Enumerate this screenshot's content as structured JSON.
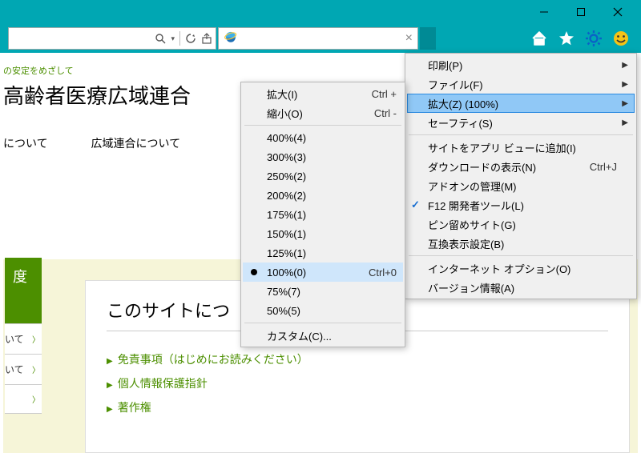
{
  "window": {
    "title": ""
  },
  "titlebar_icons": {
    "minimize": "minimize",
    "maximize": "maximize",
    "close": "close"
  },
  "addressbar": {
    "search_dropdown": "▾",
    "icons": {
      "refresh": "refresh",
      "share": "share"
    },
    "tab": {
      "close": "×"
    },
    "right_icons": {
      "home": "home",
      "star": "star",
      "gear": "gear",
      "smiley": "smiley"
    }
  },
  "page": {
    "tagline": "の安定をめざして",
    "title": "高齢者医療広域連合",
    "nav": [
      "について",
      "広域連合について"
    ],
    "side_tab": "度",
    "side_items": [
      "いて",
      "いて"
    ],
    "panel_heading": "このサイトにつ",
    "panel_links": [
      "免責事項（はじめにお読みください）",
      "個人情報保護指針",
      "著作権"
    ]
  },
  "settings_menu": {
    "items": [
      {
        "label": "印刷(P)",
        "sub": true
      },
      {
        "label": "ファイル(F)",
        "sub": true
      },
      {
        "label": "拡大(Z) (100%)",
        "sub": true,
        "highlight": true
      },
      {
        "label": "セーフティ(S)",
        "sub": true
      }
    ],
    "items2": [
      {
        "label": "サイトをアプリ ビューに追加(I)"
      },
      {
        "label": "ダウンロードの表示(N)",
        "shortcut": "Ctrl+J"
      },
      {
        "label": "アドオンの管理(M)"
      },
      {
        "label": "F12 開発者ツール(L)",
        "check": true
      },
      {
        "label": "ピン留めサイト(G)"
      },
      {
        "label": "互換表示設定(B)"
      }
    ],
    "items3": [
      {
        "label": "インターネット オプション(O)"
      },
      {
        "label": "バージョン情報(A)"
      }
    ]
  },
  "zoom_menu": {
    "top": [
      {
        "label": "拡大(I)",
        "shortcut": "Ctrl +"
      },
      {
        "label": "縮小(O)",
        "shortcut": "Ctrl -"
      }
    ],
    "levels": [
      {
        "label": "400%(4)"
      },
      {
        "label": "300%(3)"
      },
      {
        "label": "250%(2)"
      },
      {
        "label": "200%(2)"
      },
      {
        "label": "175%(1)"
      },
      {
        "label": "150%(1)"
      },
      {
        "label": "125%(1)"
      },
      {
        "label": "100%(0)",
        "shortcut": "Ctrl+0",
        "current": true
      },
      {
        "label": "75%(7)"
      },
      {
        "label": "50%(5)"
      }
    ],
    "custom": {
      "label": "カスタム(C)..."
    }
  }
}
